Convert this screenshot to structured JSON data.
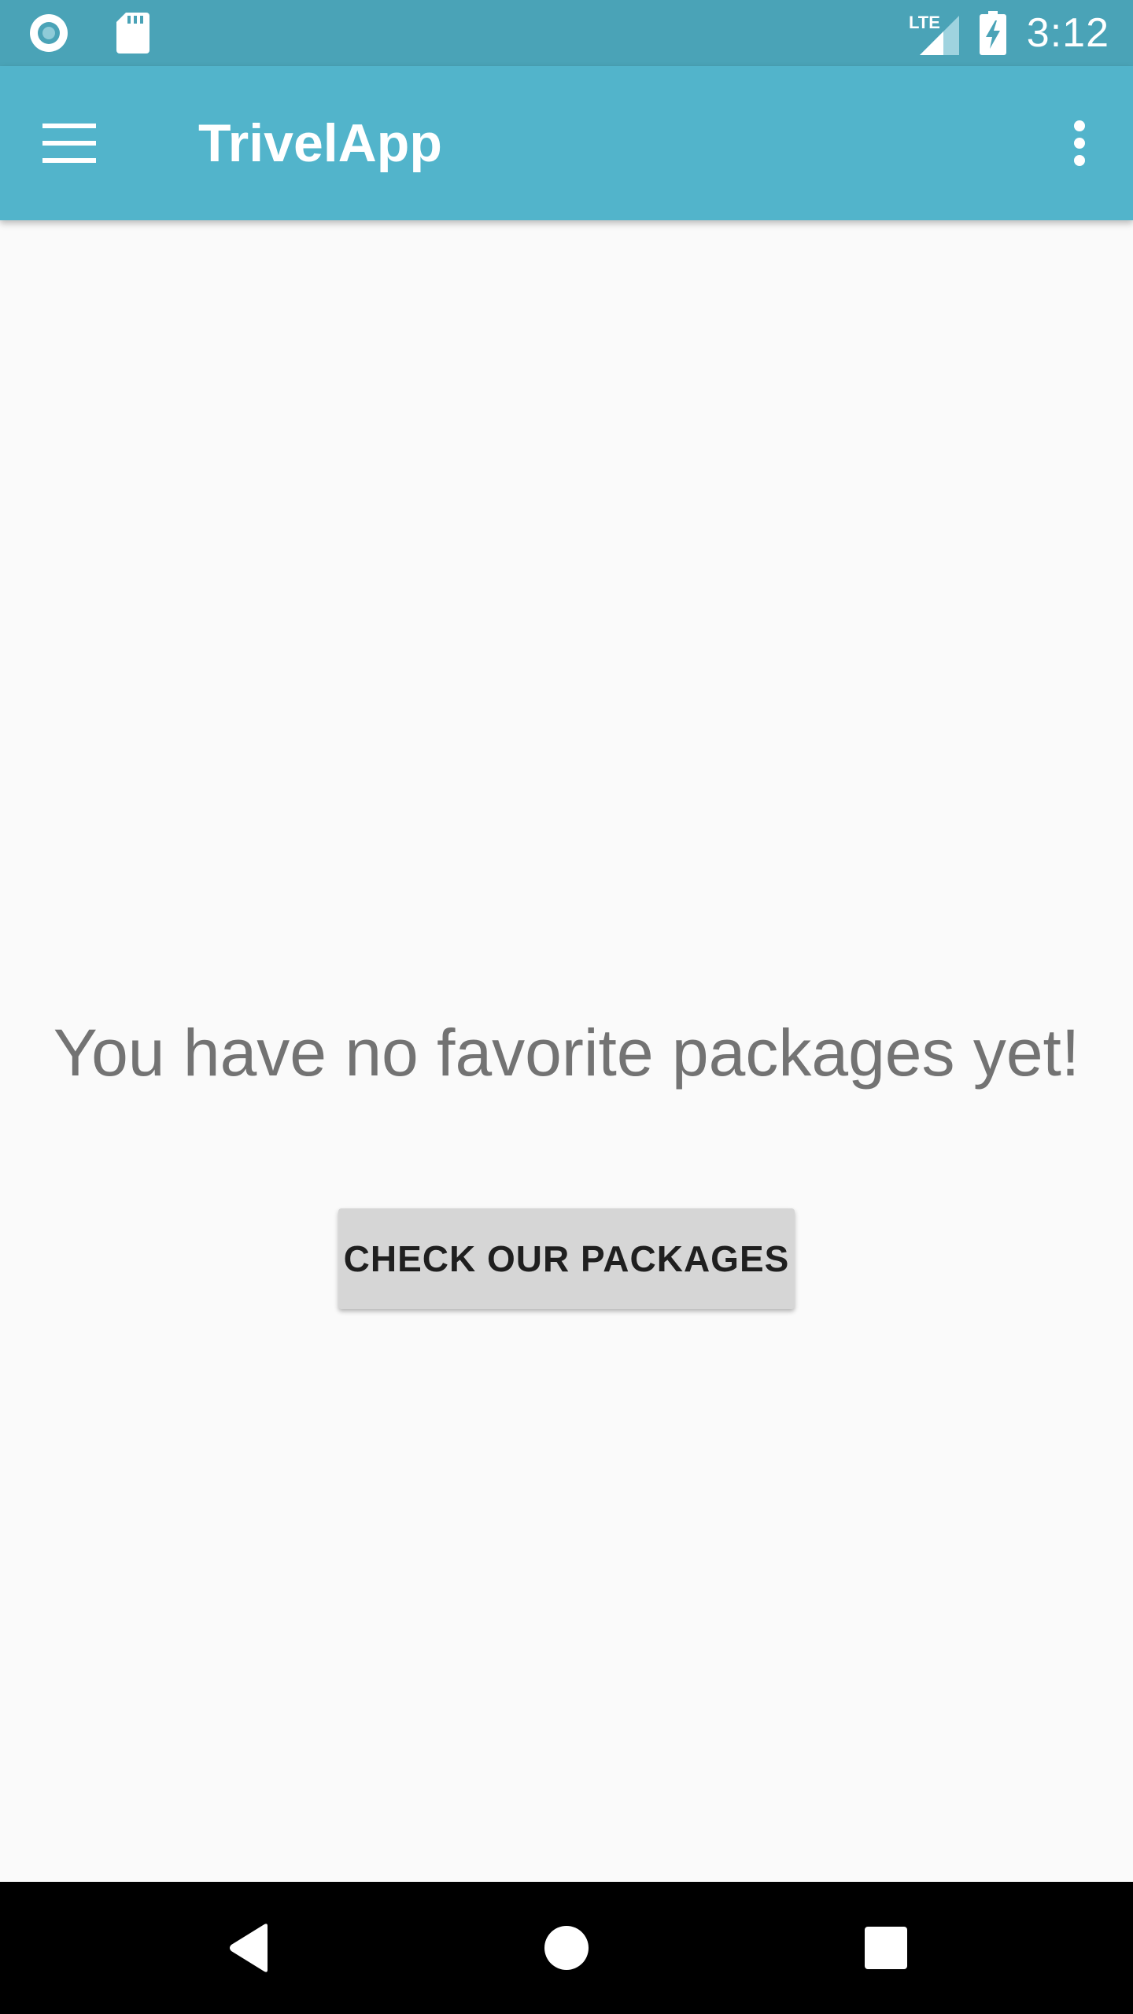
{
  "status_bar": {
    "time": "3:12",
    "network_label": "LTE",
    "icons": [
      "record-icon",
      "sd-card-icon",
      "lte-signal-icon",
      "battery-charging-icon"
    ]
  },
  "app_bar": {
    "title": "TrivelApp",
    "menu_icon": "hamburger-menu-icon",
    "overflow_icon": "more-vertical-icon"
  },
  "content": {
    "empty_message": "You have no favorite packages yet!",
    "button_label": "CHECK OUR PACKAGES"
  },
  "nav_bar": {
    "icons": [
      "back-icon",
      "home-icon",
      "recents-icon"
    ]
  },
  "colors": {
    "status_bar": "#4AA3B7",
    "app_bar": "#52B4CB",
    "background": "#FAFAFA",
    "message_text": "#737373",
    "button_bg": "#D6D6D6",
    "nav_bar": "#000000"
  }
}
